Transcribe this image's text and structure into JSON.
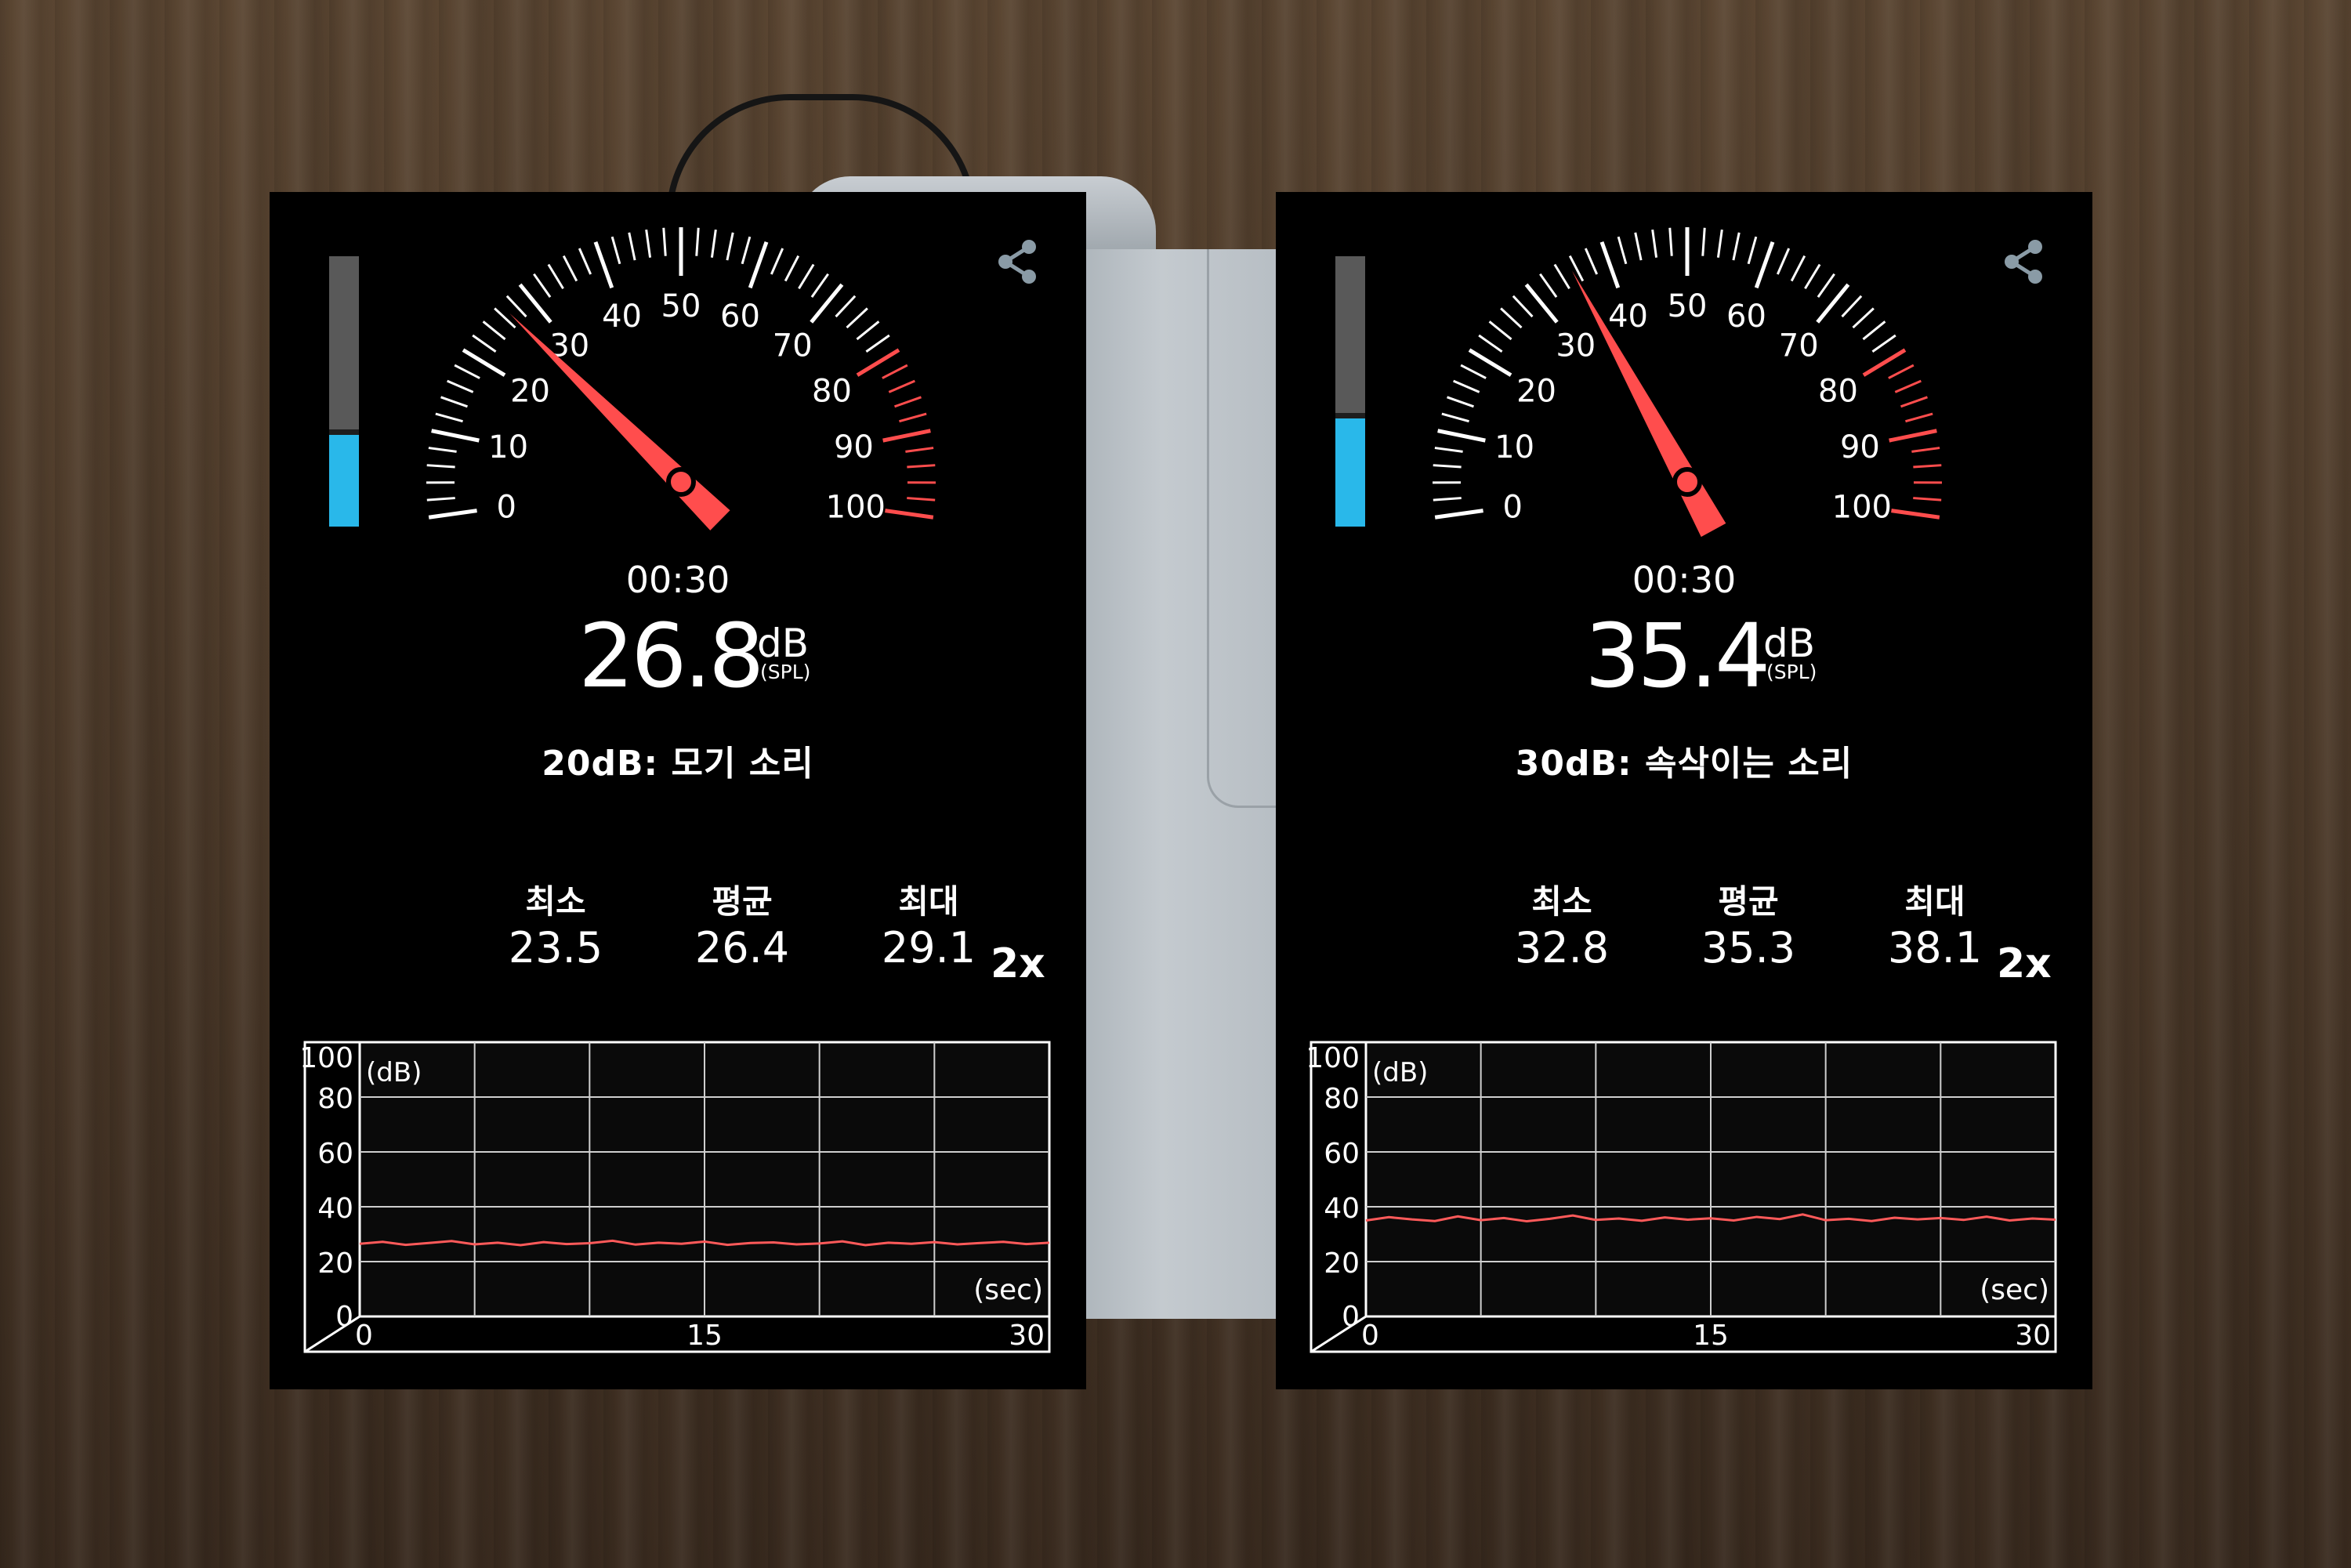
{
  "colors": {
    "needle": "#ff4d4d",
    "level_fill": "#29b8ea",
    "level_track": "#595959",
    "plot_line": "#ff5a5a",
    "danger_zone": "#ff4d4d"
  },
  "icons": {
    "share": "share-icon"
  },
  "panels": [
    {
      "gauge_ticks": [
        "0",
        "10",
        "20",
        "30",
        "40",
        "50",
        "60",
        "70",
        "80",
        "90",
        "100"
      ],
      "level_fraction": 0.34,
      "time": "00:30",
      "reading": {
        "value": "26.8",
        "unit": "dB",
        "unit_sub": "(SPL)"
      },
      "description": "20dB: 모기 소리",
      "stats": [
        {
          "label": "최소",
          "value": "23.5"
        },
        {
          "label": "평균",
          "value": "26.4"
        },
        {
          "label": "최대",
          "value": "29.1"
        }
      ],
      "speed": "2x",
      "chart_data": {
        "type": "line",
        "y_unit_label": "(dB)",
        "x_unit_label": "(sec)",
        "ylim": [
          0,
          100
        ],
        "xlim": [
          0,
          30
        ],
        "y_ticks": [
          "100",
          "80",
          "60",
          "40",
          "20",
          "0"
        ],
        "x_ticks": [
          "0",
          "15",
          "30"
        ],
        "grid": true,
        "series": [
          {
            "x": [
              0,
              1,
              2,
              3,
              4,
              5,
              6,
              7,
              8,
              9,
              10,
              11,
              12,
              13,
              14,
              15,
              16,
              17,
              18,
              19,
              20,
              21,
              22,
              23,
              24,
              25,
              26,
              27,
              28,
              29,
              30
            ],
            "y": [
              26.5,
              27.2,
              26.1,
              26.8,
              27.5,
              26.3,
              26.9,
              26.0,
              27.1,
              26.4,
              26.7,
              27.6,
              26.2,
              26.9,
              26.5,
              27.3,
              26.1,
              26.8,
              27.0,
              26.3,
              26.6,
              27.4,
              26.0,
              26.9,
              26.5,
              27.1,
              26.3,
              26.8,
              27.2,
              26.4,
              26.9
            ]
          }
        ]
      }
    },
    {
      "gauge_ticks": [
        "0",
        "10",
        "20",
        "30",
        "40",
        "50",
        "60",
        "70",
        "80",
        "90",
        "100"
      ],
      "level_fraction": 0.4,
      "time": "00:30",
      "reading": {
        "value": "35.4",
        "unit": "dB",
        "unit_sub": "(SPL)"
      },
      "description": "30dB: 속삭이는 소리",
      "stats": [
        {
          "label": "최소",
          "value": "32.8"
        },
        {
          "label": "평균",
          "value": "35.3"
        },
        {
          "label": "최대",
          "value": "38.1"
        }
      ],
      "speed": "2x",
      "chart_data": {
        "type": "line",
        "y_unit_label": "(dB)",
        "x_unit_label": "(sec)",
        "ylim": [
          0,
          100
        ],
        "xlim": [
          0,
          30
        ],
        "y_ticks": [
          "100",
          "80",
          "60",
          "40",
          "20",
          "0"
        ],
        "x_ticks": [
          "0",
          "15",
          "30"
        ],
        "grid": true,
        "series": [
          {
            "x": [
              0,
              1,
              2,
              3,
              4,
              5,
              6,
              7,
              8,
              9,
              10,
              11,
              12,
              13,
              14,
              15,
              16,
              17,
              18,
              19,
              20,
              21,
              22,
              23,
              24,
              25,
              26,
              27,
              28,
              29,
              30
            ],
            "y": [
              35.0,
              36.2,
              35.4,
              34.8,
              36.5,
              35.1,
              35.9,
              34.7,
              35.6,
              36.8,
              35.2,
              35.7,
              34.9,
              36.1,
              35.3,
              35.8,
              35.0,
              36.3,
              35.5,
              37.2,
              35.1,
              35.6,
              34.8,
              36.0,
              35.4,
              35.9,
              35.2,
              36.4,
              35.0,
              35.7,
              35.3
            ]
          }
        ]
      }
    }
  ]
}
